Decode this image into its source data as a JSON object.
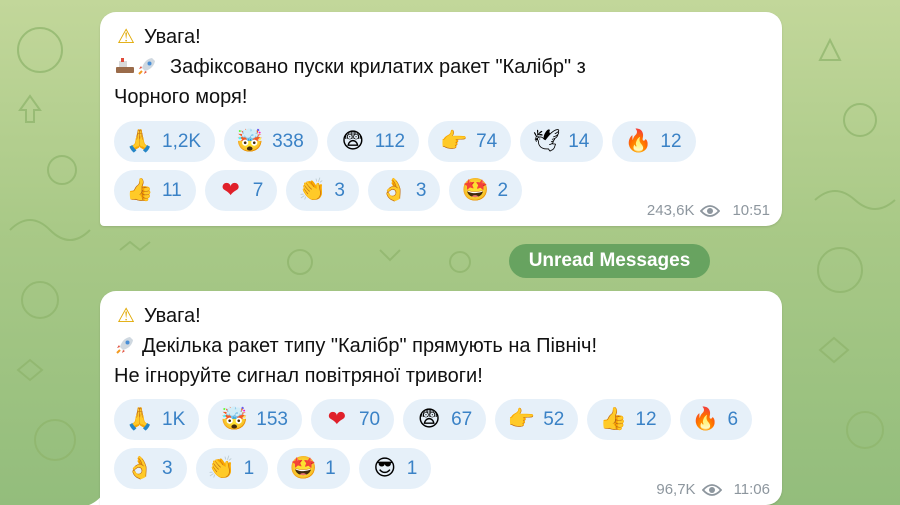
{
  "colors": {
    "background": "#a9c987",
    "bubble": "#ffffff",
    "reaction_pill": "#e6f0f9",
    "reaction_count": "#3a82c6",
    "meta_text": "#8d969e",
    "divider_bg": "#569856"
  },
  "divider": {
    "label": "Unread Messages"
  },
  "messages": [
    {
      "lines": [
        {
          "icon": "warning-icon",
          "glyph": "⚠",
          "text": "Увага!"
        },
        {
          "icon": "ship-rocket-icon",
          "glyph": "",
          "text": "Зафіксовано пуски крилатих ракет \"Калібр\" з"
        },
        {
          "icon": "",
          "glyph": "",
          "text": "Чорного моря!"
        }
      ],
      "reactions": [
        {
          "icon": "folded-hands-icon",
          "glyph": "🙏",
          "count": "1,2K"
        },
        {
          "icon": "exploding-head-icon",
          "glyph": "🤯",
          "count": "338"
        },
        {
          "icon": "fearful-face-icon",
          "glyph": "😨",
          "count": "112"
        },
        {
          "icon": "pointing-hand-icon",
          "glyph": "👉",
          "count": "74"
        },
        {
          "icon": "dove-icon",
          "glyph": "🕊",
          "count": "14"
        },
        {
          "icon": "fire-icon",
          "glyph": "🔥",
          "count": "12"
        },
        {
          "icon": "thumbs-up-icon",
          "glyph": "👍",
          "count": "11"
        },
        {
          "icon": "red-heart-icon",
          "glyph": "❤",
          "count": "7"
        },
        {
          "icon": "clapping-hands-icon",
          "glyph": "👏",
          "count": "3"
        },
        {
          "icon": "ok-hand-icon",
          "glyph": "👌",
          "count": "3"
        },
        {
          "icon": "star-struck-icon",
          "glyph": "🤩",
          "count": "2"
        }
      ],
      "views": "243,6K",
      "time": "10:51"
    },
    {
      "lines": [
        {
          "icon": "warning-icon",
          "glyph": "⚠",
          "text": "Увага!"
        },
        {
          "icon": "rocket-icon",
          "glyph": "",
          "text": "Декілька ракет типу \"Калібр\" прямують на Північ!"
        },
        {
          "icon": "",
          "glyph": "",
          "text": "Не ігноруйте сигнал повітряної тривоги!"
        }
      ],
      "reactions": [
        {
          "icon": "folded-hands-icon",
          "glyph": "🙏",
          "count": "1K"
        },
        {
          "icon": "exploding-head-icon",
          "glyph": "🤯",
          "count": "153"
        },
        {
          "icon": "red-heart-icon",
          "glyph": "❤",
          "count": "70"
        },
        {
          "icon": "fearful-face-icon",
          "glyph": "😨",
          "count": "67"
        },
        {
          "icon": "pointing-hand-icon",
          "glyph": "👉",
          "count": "52"
        },
        {
          "icon": "thumbs-up-icon",
          "glyph": "👍",
          "count": "12"
        },
        {
          "icon": "fire-icon",
          "glyph": "🔥",
          "count": "6"
        },
        {
          "icon": "ok-hand-icon",
          "glyph": "👌",
          "count": "3"
        },
        {
          "icon": "clapping-hands-icon",
          "glyph": "👏",
          "count": "1"
        },
        {
          "icon": "star-struck-icon",
          "glyph": "🤩",
          "count": "1"
        },
        {
          "icon": "sunglasses-face-icon",
          "glyph": "😎",
          "count": "1"
        }
      ],
      "views": "96,7K",
      "time": "11:06"
    }
  ]
}
